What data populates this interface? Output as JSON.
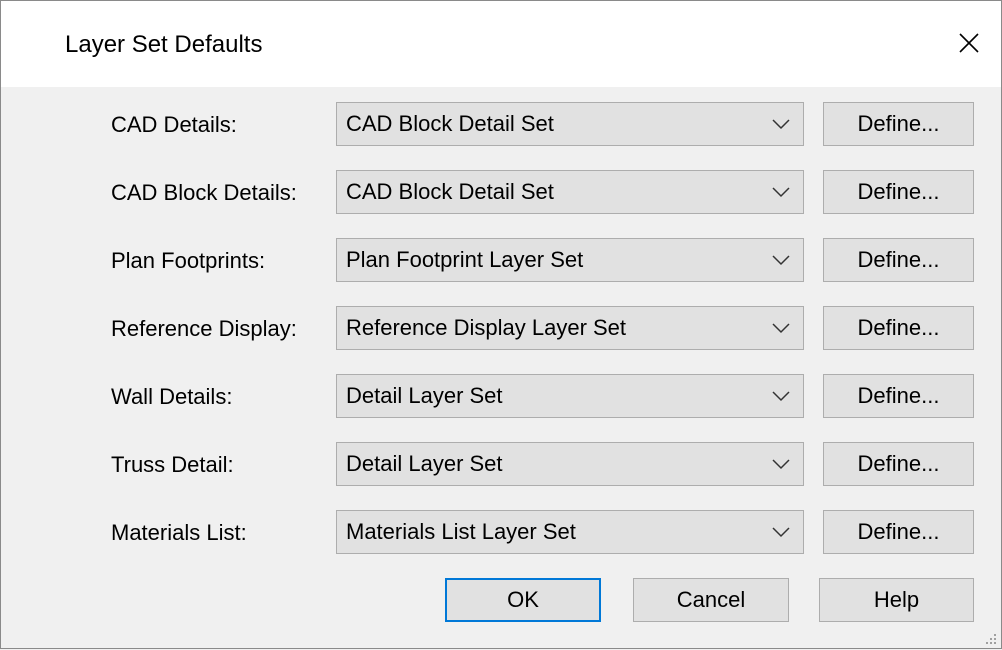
{
  "dialog": {
    "title": "Layer Set Defaults",
    "close_glyph": "✕"
  },
  "rows": [
    {
      "label": "CAD Details:",
      "value": "CAD Block Detail Set",
      "button": "Define..."
    },
    {
      "label": "CAD Block Details:",
      "value": "CAD Block Detail Set",
      "button": "Define..."
    },
    {
      "label": "Plan Footprints:",
      "value": "Plan Footprint Layer Set",
      "button": "Define..."
    },
    {
      "label": "Reference Display:",
      "value": "Reference Display Layer Set",
      "button": "Define..."
    },
    {
      "label": "Wall Details:",
      "value": "Detail Layer Set",
      "button": "Define..."
    },
    {
      "label": "Truss Detail:",
      "value": "Detail Layer Set",
      "button": "Define..."
    },
    {
      "label": "Materials List:",
      "value": "Materials List Layer Set",
      "button": "Define..."
    }
  ],
  "buttons": {
    "ok": "OK",
    "cancel": "Cancel",
    "help": "Help"
  },
  "colors": {
    "focus_border": "#0078d7",
    "button_face": "#e1e1e1",
    "dialog_bg": "#f0f0f0"
  }
}
